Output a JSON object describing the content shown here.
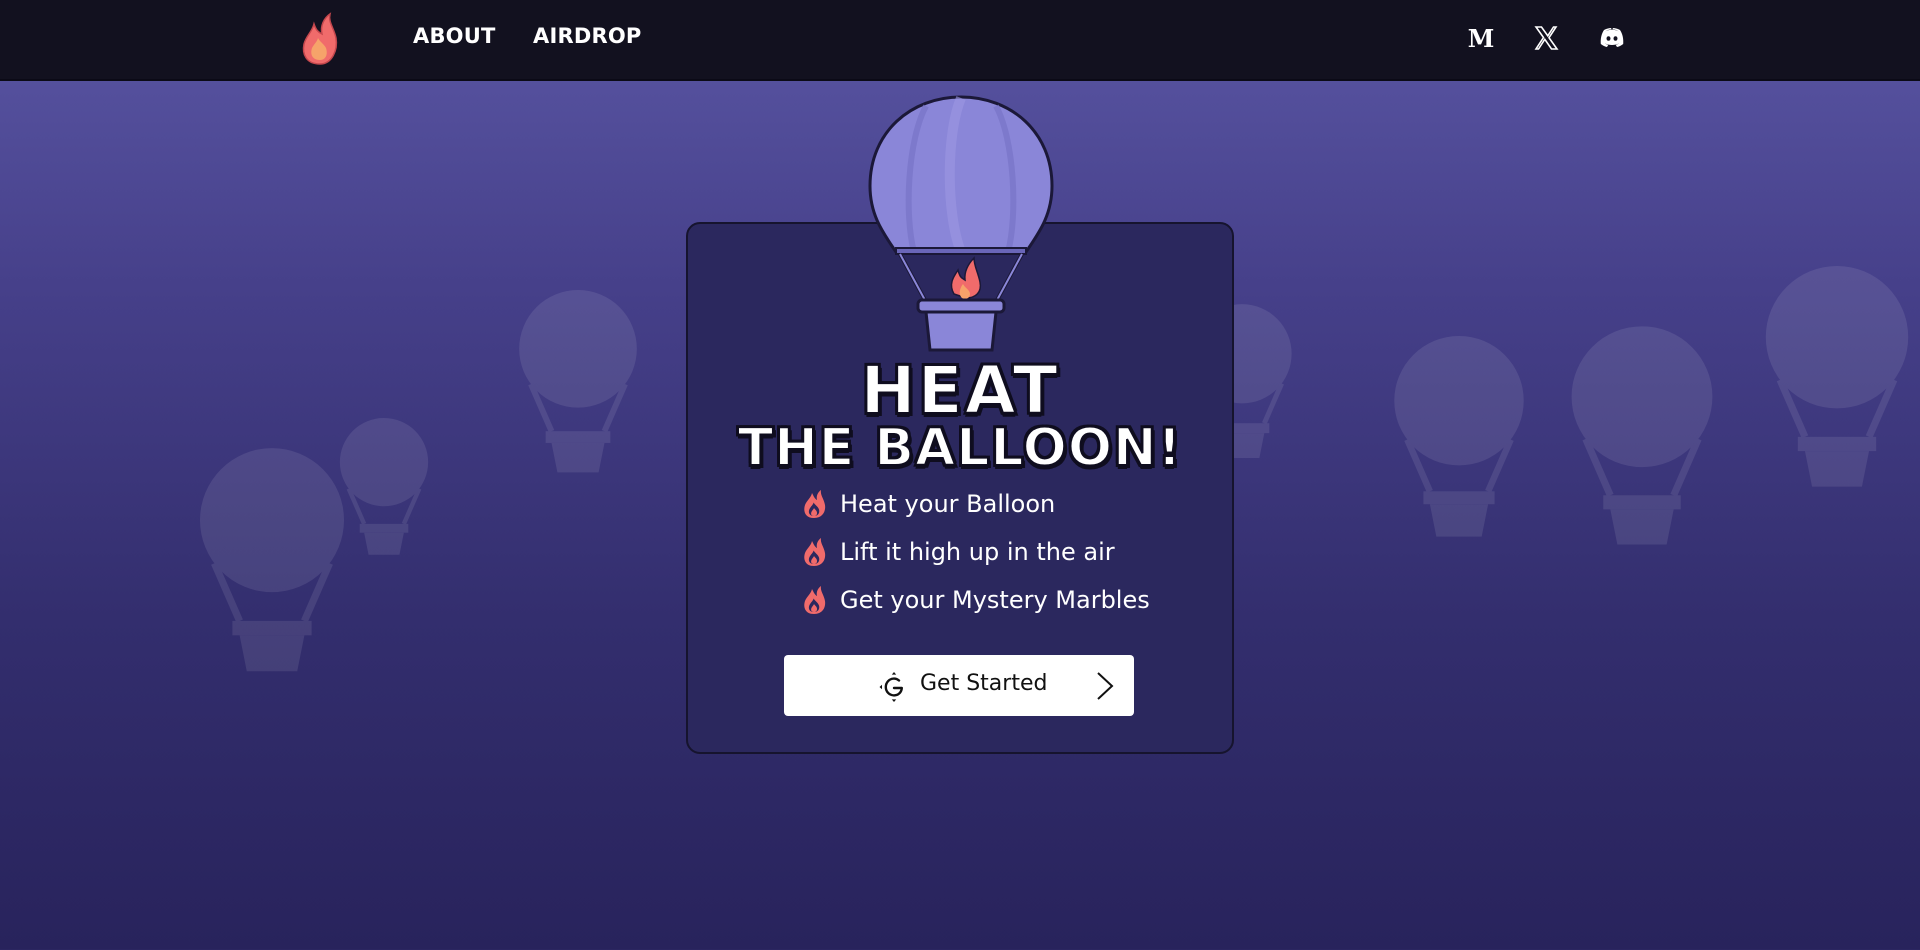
{
  "nav": {
    "about_label": "ABOUT",
    "airdrop_label": "AIRDROP",
    "social_icons": [
      "medium-icon",
      "x-icon",
      "discord-icon"
    ]
  },
  "hero": {
    "title_line1": "HEAT",
    "title_line2": "THE BALLOON!",
    "features": [
      "Heat your Balloon",
      "Lift it high up in the air",
      "Get your Mystery Marbles"
    ],
    "feature_icon": "flame-icon",
    "cta_label": "Get Started",
    "cta_icon": "g-logo-icon"
  },
  "colors": {
    "topbar": "#12111f",
    "card": "#2b285e",
    "balloon": "#8a86d8",
    "flame": "#f06b6b",
    "accent_text": "#ffffff"
  }
}
